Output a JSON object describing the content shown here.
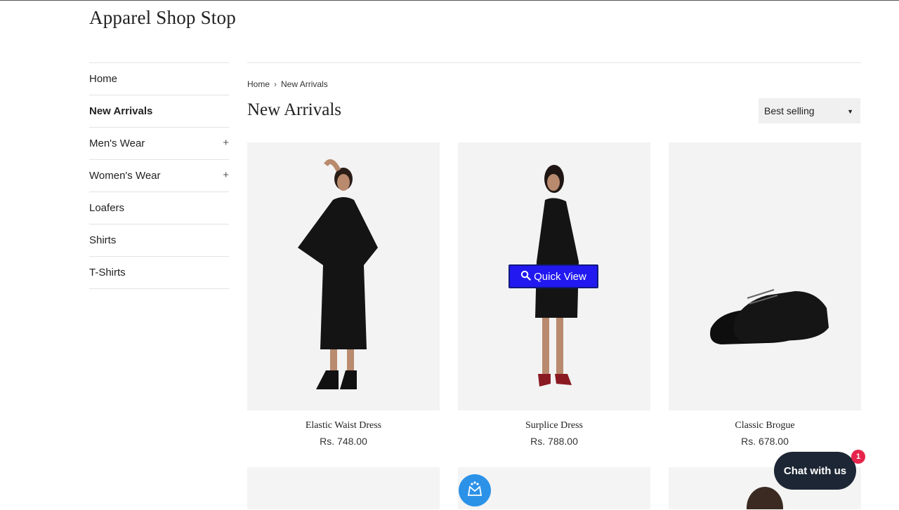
{
  "store": {
    "name": "Apparel Shop Stop"
  },
  "sidebar": {
    "items": [
      {
        "label": "Home"
      },
      {
        "label": "New Arrivals"
      },
      {
        "label": "Men's Wear",
        "expand": "+"
      },
      {
        "label": "Women's Wear",
        "expand": "+"
      },
      {
        "label": "Loafers"
      },
      {
        "label": "Shirts"
      },
      {
        "label": "T-Shirts"
      }
    ]
  },
  "breadcrumb": {
    "home": "Home",
    "separator": "›",
    "current": "New Arrivals"
  },
  "page": {
    "title": "New Arrivals"
  },
  "sort": {
    "selected": "Best selling"
  },
  "products": [
    {
      "name": "Elastic Waist Dress",
      "price": "Rs. 748.00"
    },
    {
      "name": "Surplice Dress",
      "price": "Rs. 788.00"
    },
    {
      "name": "Classic Brogue",
      "price": "Rs. 678.00"
    }
  ],
  "quick_view": {
    "label": "Quick View"
  },
  "chat": {
    "label": "Chat with us",
    "badge": "1"
  },
  "icons": {
    "search": "search-icon",
    "caret": "caret-down-icon",
    "plus": "plus-icon",
    "chat": "chat-icon",
    "loyalty": "loyalty-icon"
  },
  "colors": {
    "quick_view_bg": "#2219f0",
    "chat_bg": "#1d2634",
    "badge_bg": "#e5254b",
    "loyalty_bg": "#2c92e8"
  }
}
